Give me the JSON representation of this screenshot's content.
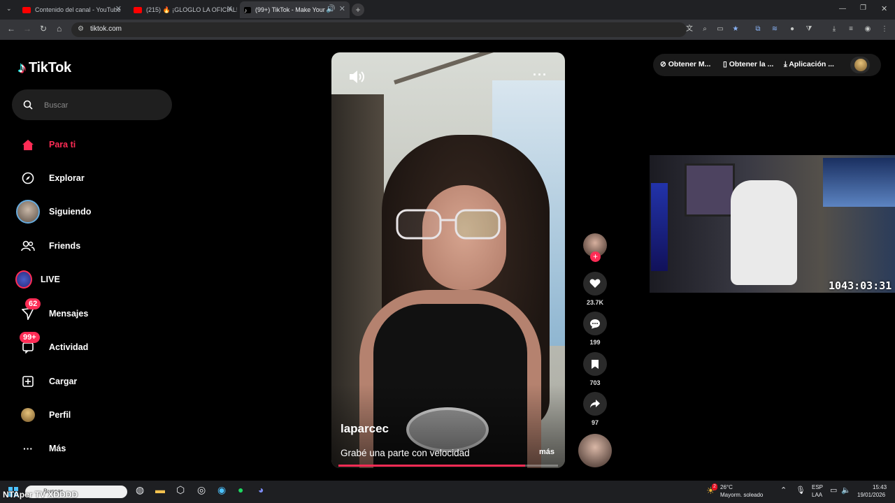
{
  "browser": {
    "tabs": [
      {
        "title": "Contenido del canal - YouTube",
        "color": "#ff0000"
      },
      {
        "title": "(215) 🔥 ¡GLOGLO LA OFICIAL!",
        "color": "#ff0000"
      },
      {
        "title": "(99+) TikTok - Make Your Day",
        "color": "#ffffff"
      }
    ],
    "url": "tiktok.com"
  },
  "sidebar": {
    "logo": "TikTok",
    "search_placeholder": "Buscar",
    "items": [
      {
        "label": "Para ti",
        "icon": "home-icon",
        "active": true
      },
      {
        "label": "Explorar",
        "icon": "compass-icon"
      },
      {
        "label": "Siguiendo",
        "icon": "avatar"
      },
      {
        "label": "Friends",
        "icon": "friends-icon"
      },
      {
        "label": "LIVE",
        "icon": "live-icon"
      },
      {
        "label": "Mensajes",
        "icon": "messages-icon",
        "badge": "62"
      },
      {
        "label": "Actividad",
        "icon": "activity-icon",
        "badge": "99+"
      },
      {
        "label": "Cargar",
        "icon": "upload-icon"
      },
      {
        "label": "Perfil",
        "icon": "profile-avatar"
      },
      {
        "label": "Más",
        "icon": "more-icon"
      }
    ]
  },
  "video": {
    "author": "laparcec",
    "caption": "Grabé una parte con velocidad",
    "more_label": "más",
    "progress": 0.85
  },
  "actions": {
    "likes": "23.7K",
    "comments": "199",
    "saves": "703",
    "shares": "97"
  },
  "top_right": {
    "get_coins": "Obtener M...",
    "get_app": "Obtener la ...",
    "download_app": "Aplicación ..."
  },
  "stream": {
    "timer": "1043:03:31",
    "watermark": "NTAper TV XDDDD"
  },
  "taskbar": {
    "search_placeholder": "Buscar",
    "weather_temp": "26°C",
    "weather_desc": "Mayorm. soleado",
    "weather_badge": "2",
    "lang": "ESP",
    "layout": "LAA",
    "time": "15:43",
    "date": "19/01/2026"
  },
  "colors": {
    "accent": "#fe2c55",
    "background": "#000000",
    "sidebar_search_bg": "#1f1f1f"
  }
}
